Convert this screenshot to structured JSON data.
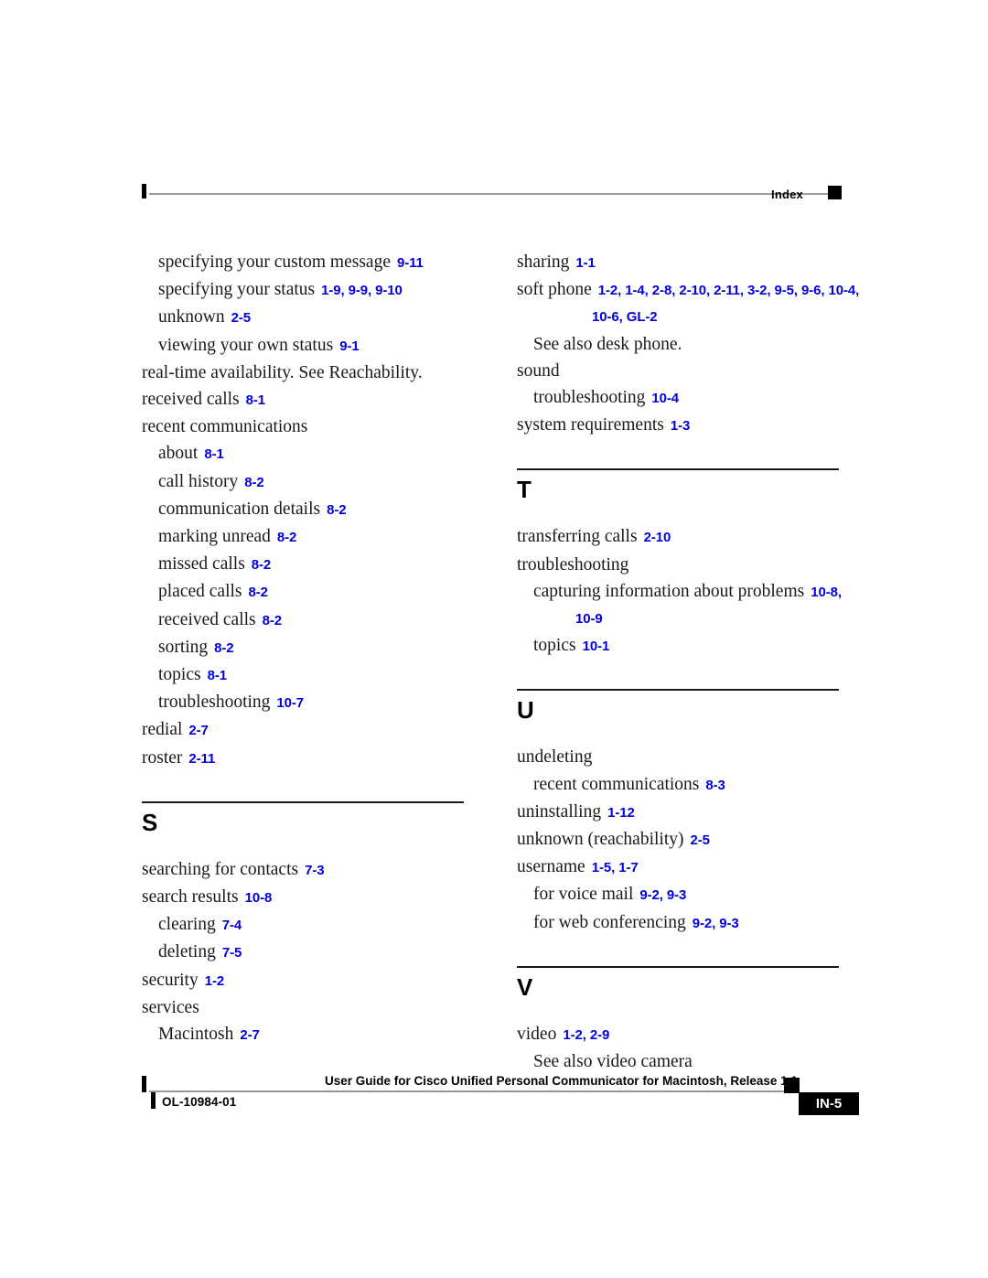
{
  "header": {
    "label": "Index"
  },
  "columns": {
    "left": {
      "continued_entries": [
        {
          "indent": 1,
          "term": "specifying your custom message",
          "refs": "9-11"
        },
        {
          "indent": 1,
          "term": "specifying your status",
          "refs": "1-9, 9-9, 9-10"
        },
        {
          "indent": 1,
          "term": "unknown",
          "refs": "2-5"
        },
        {
          "indent": 1,
          "term": "viewing your own status",
          "refs": "9-1"
        },
        {
          "indent": 0,
          "term": "real-time availability. See Reachability.",
          "refs": ""
        },
        {
          "indent": 0,
          "term": "received calls",
          "refs": "8-1"
        },
        {
          "indent": 0,
          "term": "recent communications",
          "refs": ""
        },
        {
          "indent": 1,
          "term": "about",
          "refs": "8-1"
        },
        {
          "indent": 1,
          "term": "call history",
          "refs": "8-2"
        },
        {
          "indent": 1,
          "term": "communication details",
          "refs": "8-2"
        },
        {
          "indent": 1,
          "term": "marking unread",
          "refs": "8-2"
        },
        {
          "indent": 1,
          "term": "missed calls",
          "refs": "8-2"
        },
        {
          "indent": 1,
          "term": "placed calls",
          "refs": "8-2"
        },
        {
          "indent": 1,
          "term": "received calls",
          "refs": "8-2"
        },
        {
          "indent": 1,
          "term": "sorting",
          "refs": "8-2"
        },
        {
          "indent": 1,
          "term": "topics",
          "refs": "8-1"
        },
        {
          "indent": 1,
          "term": "troubleshooting",
          "refs": "10-7"
        },
        {
          "indent": 0,
          "term": "redial",
          "refs": "2-7"
        },
        {
          "indent": 0,
          "term": "roster",
          "refs": "2-11"
        }
      ],
      "section_s": {
        "letter": "S",
        "entries": [
          {
            "indent": 0,
            "term": "searching for contacts",
            "refs": "7-3"
          },
          {
            "indent": 0,
            "term": "search results",
            "refs": "10-8"
          },
          {
            "indent": 1,
            "term": "clearing",
            "refs": "7-4"
          },
          {
            "indent": 1,
            "term": "deleting",
            "refs": "7-5"
          },
          {
            "indent": 0,
            "term": "security",
            "refs": "1-2"
          },
          {
            "indent": 0,
            "term": "services",
            "refs": ""
          },
          {
            "indent": 1,
            "term": "Macintosh",
            "refs": "2-7"
          }
        ]
      }
    },
    "right": {
      "continued_entries": [
        {
          "indent": 0,
          "term": "sharing",
          "refs": "1-1"
        },
        {
          "indent": 0,
          "term": "soft phone",
          "refs": "1-2, 1-4, 2-8, 2-10, 2-11, 3-2, 9-5, 9-6, 10-4,",
          "refs_continued": "10-6, GL-2"
        },
        {
          "indent": 1,
          "term": "See also desk phone.",
          "refs": ""
        },
        {
          "indent": 0,
          "term": "sound",
          "refs": ""
        },
        {
          "indent": 1,
          "term": "troubleshooting",
          "refs": "10-4"
        },
        {
          "indent": 0,
          "term": "system requirements",
          "refs": "1-3"
        }
      ],
      "section_t": {
        "letter": "T",
        "entries": [
          {
            "indent": 0,
            "term": "transferring calls",
            "refs": "2-10"
          },
          {
            "indent": 0,
            "term": "troubleshooting",
            "refs": ""
          },
          {
            "indent": 1,
            "term": "capturing information about problems",
            "refs": "10-8,",
            "refs_continued": "10-9"
          },
          {
            "indent": 1,
            "term": "topics",
            "refs": "10-1"
          }
        ]
      },
      "section_u": {
        "letter": "U",
        "entries": [
          {
            "indent": 0,
            "term": "undeleting",
            "refs": ""
          },
          {
            "indent": 1,
            "term": "recent communications",
            "refs": "8-3"
          },
          {
            "indent": 0,
            "term": "uninstalling",
            "refs": "1-12"
          },
          {
            "indent": 0,
            "term": "unknown (reachability)",
            "refs": "2-5"
          },
          {
            "indent": 0,
            "term": "username",
            "refs": "1-5, 1-7"
          },
          {
            "indent": 1,
            "term": "for voice mail",
            "refs": "9-2, 9-3"
          },
          {
            "indent": 1,
            "term": "for web conferencing",
            "refs": "9-2, 9-3"
          }
        ]
      },
      "section_v": {
        "letter": "V",
        "entries": [
          {
            "indent": 0,
            "term": "video",
            "refs": "1-2, 2-9"
          },
          {
            "indent": 1,
            "term": "See also video camera",
            "refs": ""
          }
        ]
      }
    }
  },
  "footer": {
    "doc_id": "OL-10984-01",
    "title": "User Guide for Cisco Unified Personal Communicator for Macintosh, Release 1.1",
    "page_number": "IN-5"
  },
  "colors": {
    "reference_blue": "#0000e0",
    "text_black": "#1a1a1a",
    "rule_gray": "#9a9a9a"
  }
}
